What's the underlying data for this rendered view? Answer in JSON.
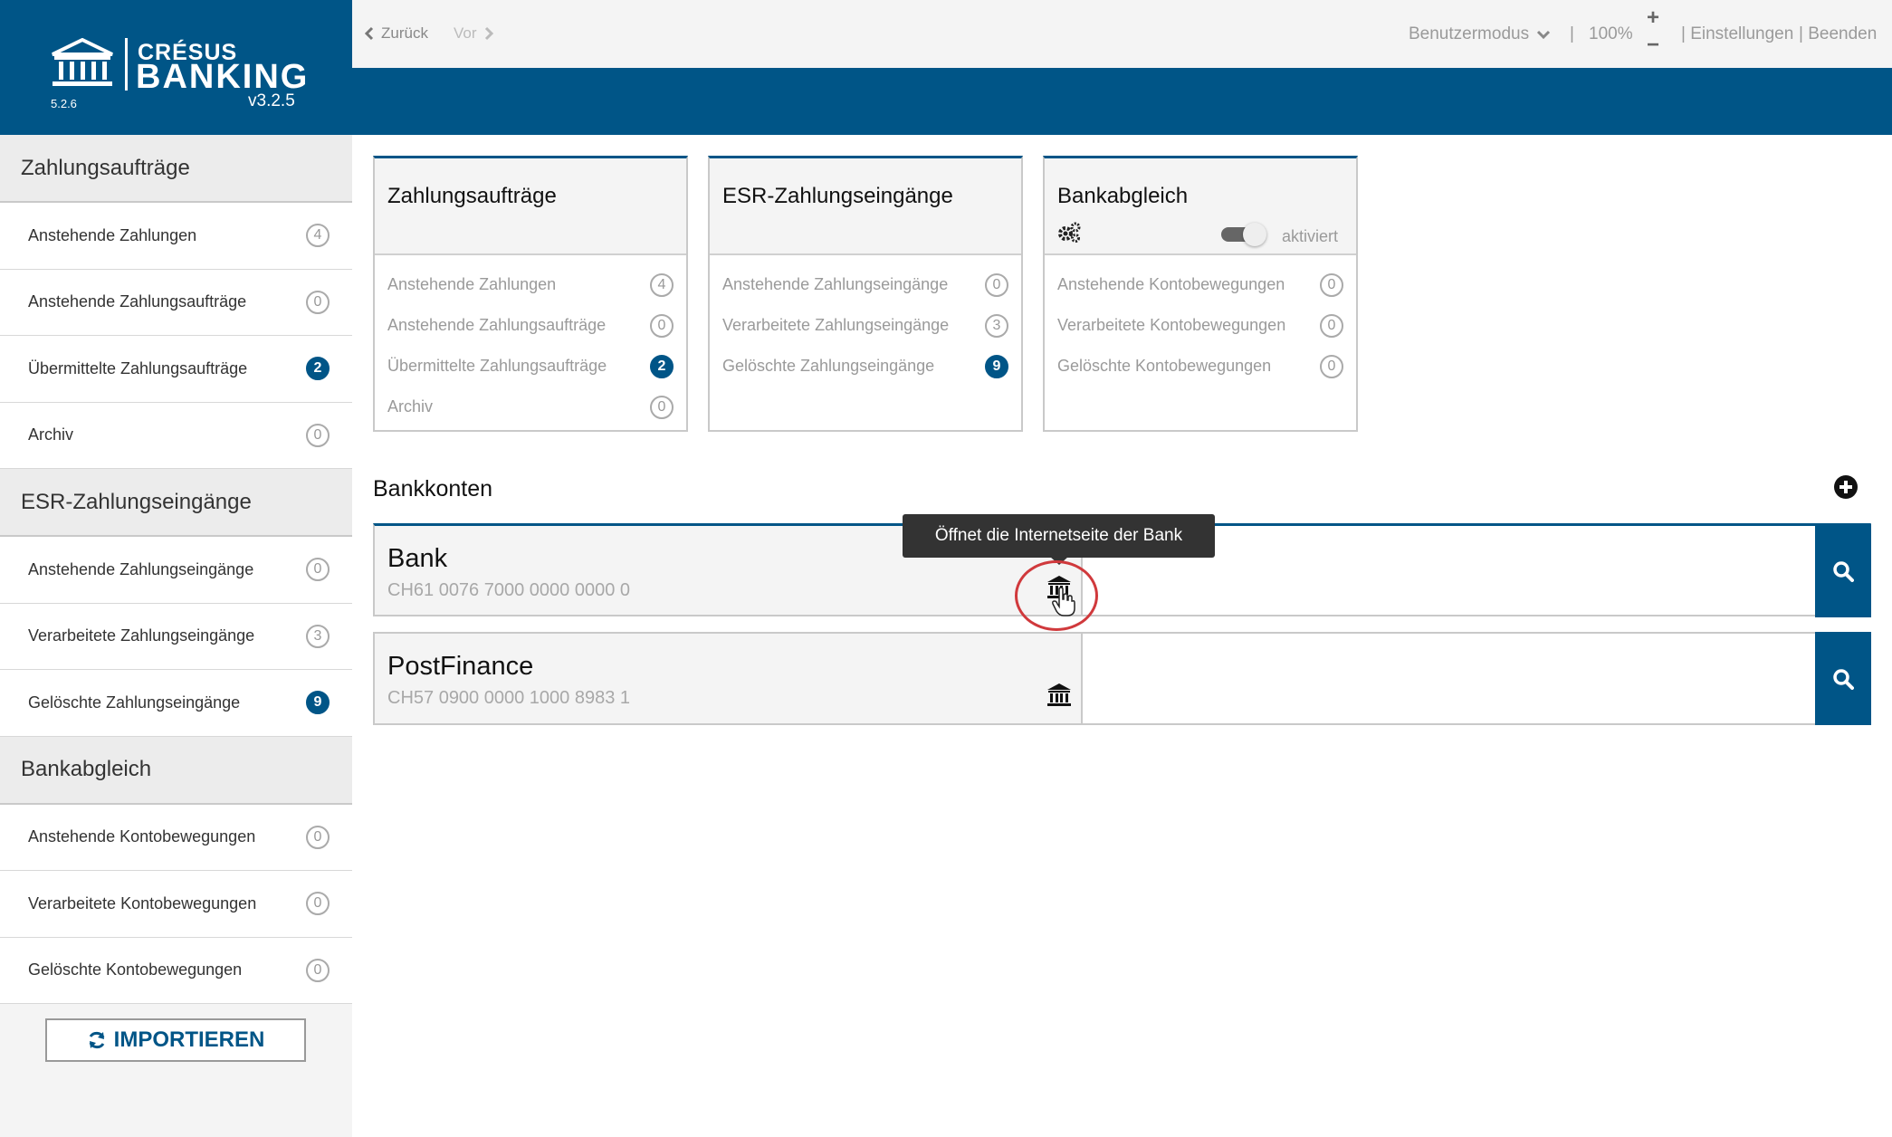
{
  "logo": {
    "brand_top": "CRÉSUS",
    "brand_main": "BANKING",
    "version_small": "5.2.6",
    "version_app": "v3.2.5"
  },
  "topbar": {
    "back": "Zurück",
    "forward": "Vor",
    "mode": "Benutzermodus",
    "zoom": "100%",
    "zoom_sep": "|",
    "settings": "| Einstellungen",
    "quit": "| Beenden",
    "zoom_in": "+",
    "zoom_out": "−"
  },
  "sidebar": {
    "sections": [
      {
        "title": "Zahlungsaufträge",
        "items": [
          {
            "label": "Anstehende Zahlungen",
            "count": "4",
            "filled": false
          },
          {
            "label": "Anstehende Zahlungsaufträge",
            "count": "0",
            "filled": false
          },
          {
            "label": "Übermittelte Zahlungsaufträge",
            "count": "2",
            "filled": true
          },
          {
            "label": "Archiv",
            "count": "0",
            "filled": false
          }
        ]
      },
      {
        "title": "ESR-Zahlungseingänge",
        "items": [
          {
            "label": "Anstehende Zahlungseingänge",
            "count": "0",
            "filled": false
          },
          {
            "label": "Verarbeitete Zahlungseingänge",
            "count": "3",
            "filled": false
          },
          {
            "label": "Gelöschte Zahlungseingänge",
            "count": "9",
            "filled": true
          }
        ]
      },
      {
        "title": "Bankabgleich",
        "items": [
          {
            "label": "Anstehende Kontobewegungen",
            "count": "0",
            "filled": false
          },
          {
            "label": "Verarbeitete Kontobewegungen",
            "count": "0",
            "filled": false
          },
          {
            "label": "Gelöschte Kontobewegungen",
            "count": "0",
            "filled": false
          }
        ]
      }
    ],
    "import_label": "IMPORTIEREN"
  },
  "cards": [
    {
      "title": "Zahlungsaufträge",
      "rows": [
        {
          "label": "Anstehende Zahlungen",
          "count": "4",
          "filled": false
        },
        {
          "label": "Anstehende Zahlungsaufträge",
          "count": "0",
          "filled": false
        },
        {
          "label": "Übermittelte Zahlungsaufträge",
          "count": "2",
          "filled": true
        },
        {
          "label": "Archiv",
          "count": "0",
          "filled": false
        }
      ]
    },
    {
      "title": "ESR-Zahlungseingänge",
      "rows": [
        {
          "label": "Anstehende Zahlungseingänge",
          "count": "0",
          "filled": false
        },
        {
          "label": "Verarbeitete Zahlungseingänge",
          "count": "3",
          "filled": false
        },
        {
          "label": "Gelöschte Zahlungseingänge",
          "count": "9",
          "filled": true
        }
      ]
    },
    {
      "title": "Bankabgleich",
      "toggle_label": "aktiviert",
      "toggle_on": true,
      "rows": [
        {
          "label": "Anstehende Kontobewegungen",
          "count": "0",
          "filled": false
        },
        {
          "label": "Verarbeitete Kontobewegungen",
          "count": "0",
          "filled": false
        },
        {
          "label": "Gelöschte Kontobewegungen",
          "count": "0",
          "filled": false
        }
      ]
    }
  ],
  "accounts": {
    "title": "Bankkonten",
    "list": [
      {
        "name": "Bank",
        "iban": "CH61 0076 7000 0000 0000 0"
      },
      {
        "name": "PostFinance",
        "iban": "CH57 0900 0000 1000 8983 1"
      }
    ]
  },
  "tooltip": "Öffnet die Internetseite der Bank",
  "colors": {
    "brand": "#005587",
    "highlight": "#d0393c"
  }
}
